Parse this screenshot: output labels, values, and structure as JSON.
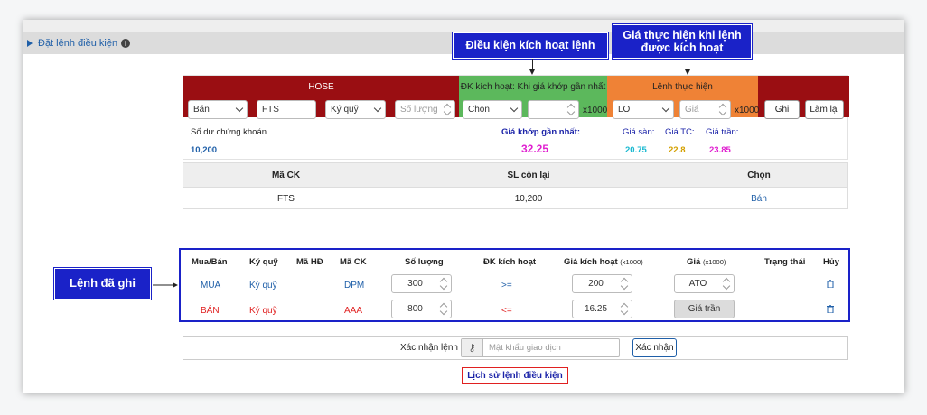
{
  "section": {
    "title": "Đặt lệnh điều kiện",
    "info_icon": "info-circle-icon"
  },
  "callouts": {
    "trigger": "Điều kiện kích hoạt lệnh",
    "exec_line1": "Giá thực hiện khi lệnh",
    "exec_line2": "được kích hoạt",
    "saved": "Lệnh đã ghi"
  },
  "order_form": {
    "exchange": "HOSE",
    "side": "Bán",
    "symbol": "FTS",
    "account_type": "Ký quỹ",
    "quantity_placeholder": "Số lượng",
    "trigger_title": "ĐK kích hoạt: Khi giá khớp gần nhất",
    "trigger_select": "Chọn",
    "unit": "x1000",
    "exec_title": "Lệnh thực hiện",
    "order_type": "LO",
    "price_placeholder": "Giá",
    "save_label": "Ghi",
    "reset_label": "Làm lại",
    "balance_label": "Số dư chứng khoán",
    "balance_value": "10,200",
    "last_price_label": "Giá khớp gần nhất:",
    "last_price_value": "32.25",
    "floor_label": "Giá sàn:",
    "floor_value": "20.75",
    "ref_label": "Giá TC:",
    "ref_value": "22.8",
    "ceiling_label": "Giá trần:",
    "ceiling_value": "23.85"
  },
  "holdings": {
    "headers": [
      "Mã CK",
      "SL còn lại",
      "Chọn"
    ],
    "row": {
      "symbol": "FTS",
      "remaining": "10,200",
      "action": "Bán"
    }
  },
  "saved_orders": {
    "headers": [
      "Mua/Bán",
      "Ký quỹ",
      "Mã HĐ",
      "Mã CK",
      "Số lượng",
      "ĐK kích hoạt",
      "Giá kích hoạt",
      "Giá",
      "Trạng thái",
      "Hủy"
    ],
    "header_suffixes": {
      "trigger_price": "(x1000)",
      "price": "(x1000)"
    },
    "rows": [
      {
        "side": "MUA",
        "account": "Ký quỹ",
        "contract": "",
        "symbol": "DPM",
        "quantity": "300",
        "condition": ">=",
        "trigger_price": "200",
        "price": "ATO"
      },
      {
        "side": "BÁN",
        "account": "Ký quỹ",
        "contract": "",
        "symbol": "AAA",
        "quantity": "800",
        "condition": "<=",
        "trigger_price": "16.25",
        "price": "Giá trần"
      }
    ]
  },
  "confirm": {
    "label": "Xác nhận lệnh",
    "password_placeholder": "Mật khẩu giao dịch",
    "button": "Xác nhận"
  },
  "history_link": "Lịch sử lệnh điều kiện",
  "colors": {
    "hose_band": "#9a0e12",
    "trigger_band": "#5cb85c",
    "exec_band": "#ef8236",
    "callout": "#1a22c8",
    "buy": "#1f5fa8",
    "sell": "#e02020",
    "floor": "#18b8d0",
    "ref": "#d4a000",
    "ceiling": "#e020d0",
    "last_price": "#e020d0"
  }
}
